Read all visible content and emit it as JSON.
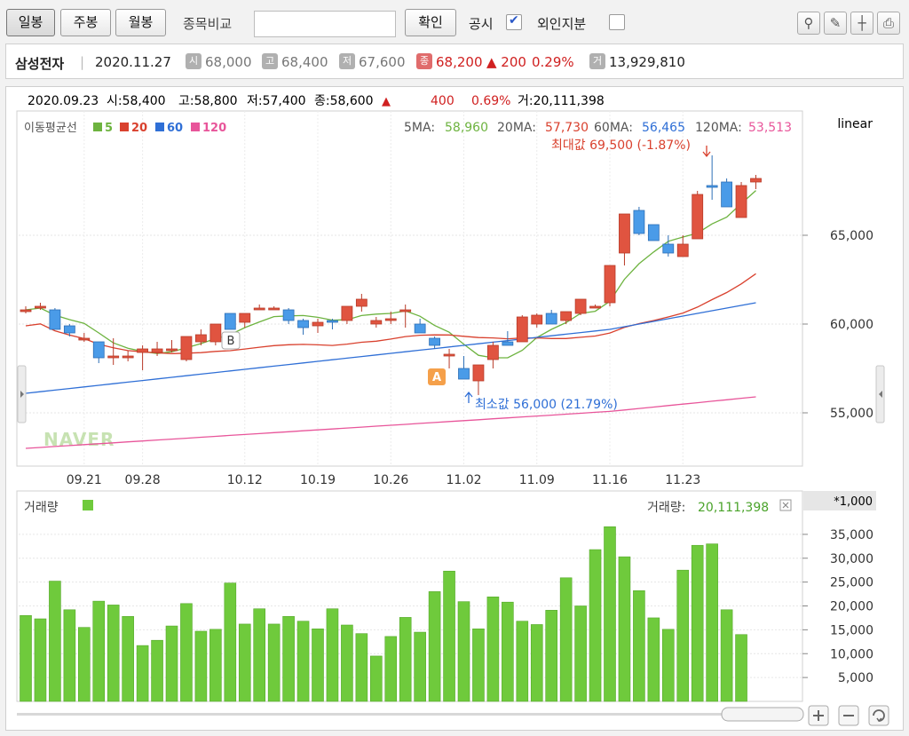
{
  "toolbar": {
    "daily_label": "일봉",
    "weekly_label": "주봉",
    "monthly_label": "월봉",
    "compare_label": "종목비교",
    "compare_placeholder": "",
    "confirm_label": "확인",
    "disclosure_label": "공시",
    "disclosure_checked": true,
    "foreign_label": "외인지분",
    "foreign_checked": false,
    "icons": [
      "pin-icon",
      "draw-icon",
      "cursor-icon",
      "print-icon"
    ]
  },
  "quote": {
    "name": "삼성전자",
    "date": "2020.11.27",
    "open_tag": "시",
    "open": "68,000",
    "high_tag": "고",
    "high": "68,400",
    "low_tag": "저",
    "low": "67,600",
    "close_tag": "종",
    "close": "68,200",
    "change": "▲ 200",
    "change_pct": "0.29%",
    "volume_tag": "거",
    "volume": "13,929,810"
  },
  "hover_info": {
    "date": "2020.09.23",
    "open": "시:58,400",
    "high": "고:58,800",
    "low": "저:57,400",
    "close": "종:58,600",
    "arrow": "▲",
    "change": "400",
    "change_pct": "0.69%",
    "volume": "거:20,111,398"
  },
  "chart_data": [
    {
      "type": "candlestick",
      "title": "",
      "scale_label": "linear",
      "ylim": [
        52000,
        72000
      ],
      "y_ticks": [
        "55,000",
        "60,000",
        "65,000"
      ],
      "x_ticks": [
        "09.21",
        "09.28",
        "10.12",
        "10.19",
        "10.26",
        "11.02",
        "11.09",
        "11.16",
        "11.23"
      ],
      "legend_title": "이동평균선",
      "legend": [
        {
          "name": "5",
          "color": "#6db33f"
        },
        {
          "name": "20",
          "color": "#d9412e"
        },
        {
          "name": "60",
          "color": "#2f6fd6"
        },
        {
          "name": "120",
          "color": "#e8559a"
        }
      ],
      "ma_values": [
        {
          "label": "5MA:",
          "value": "58,960",
          "color": "#6db33f"
        },
        {
          "label": "20MA:",
          "value": "57,730",
          "color": "#d9412e"
        },
        {
          "label": "60MA:",
          "value": "56,465",
          "color": "#2f6fd6"
        },
        {
          "label": "120MA:",
          "value": "53,513",
          "color": "#e8559a"
        }
      ],
      "max_label": "최대값 69,500 (-1.87%)",
      "min_label": "최소값 56,000 (21.79%)",
      "marker_a": "A",
      "marker_b": "B",
      "watermark": "NAVER",
      "candles": [
        [
          60800,
          61000,
          60600,
          60800
        ],
        [
          61000,
          61200,
          60800,
          61000
        ],
        [
          60800,
          60900,
          59700,
          59700
        ],
        [
          59900,
          60000,
          59300,
          59500
        ],
        [
          59200,
          59500,
          59000,
          59200
        ],
        [
          59000,
          59000,
          57800,
          58100
        ],
        [
          58200,
          59200,
          57700,
          58200
        ],
        [
          58100,
          58500,
          57900,
          58200
        ],
        [
          58400,
          58800,
          57400,
          58600
        ],
        [
          58400,
          59000,
          58200,
          58600
        ],
        [
          58600,
          59100,
          58400,
          58600
        ],
        [
          58000,
          59300,
          57900,
          59300
        ],
        [
          59000,
          59700,
          58800,
          59400
        ],
        [
          59000,
          60000,
          58800,
          60000
        ],
        [
          60600,
          60600,
          59700,
          59700
        ],
        [
          60100,
          60500,
          59800,
          60600
        ],
        [
          60900,
          61100,
          60800,
          60900
        ],
        [
          60900,
          61000,
          60800,
          60900
        ],
        [
          60800,
          60900,
          60000,
          60200
        ],
        [
          60200,
          60300,
          59400,
          59800
        ],
        [
          59900,
          60300,
          59500,
          60100
        ],
        [
          60200,
          60300,
          59700,
          60100
        ],
        [
          60200,
          61000,
          60000,
          61000
        ],
        [
          61000,
          61700,
          60700,
          61400
        ],
        [
          60000,
          60400,
          59800,
          60200
        ],
        [
          60200,
          60700,
          60000,
          60300
        ],
        [
          60800,
          61100,
          59800,
          60800
        ],
        [
          60000,
          60300,
          59600,
          59500
        ],
        [
          59200,
          59300,
          58600,
          58800
        ],
        [
          58200,
          58600,
          57500,
          58300
        ],
        [
          57500,
          58200,
          56900,
          56900
        ],
        [
          56800,
          57000,
          56000,
          57700
        ],
        [
          58000,
          59000,
          57500,
          58800
        ],
        [
          59000,
          59600,
          58800,
          58800
        ],
        [
          59000,
          60500,
          59000,
          60400
        ],
        [
          60000,
          60600,
          59800,
          60500
        ],
        [
          60600,
          60800,
          60000,
          60000
        ],
        [
          60200,
          60600,
          60000,
          60700
        ],
        [
          60600,
          61400,
          60500,
          61400
        ],
        [
          61000,
          61100,
          60900,
          61000
        ],
        [
          61200,
          63300,
          61000,
          63300
        ],
        [
          64000,
          66200,
          63300,
          66200
        ],
        [
          66400,
          66600,
          65000,
          65100
        ],
        [
          65600,
          65600,
          64800,
          64700
        ],
        [
          64500,
          65000,
          63800,
          64000
        ],
        [
          63800,
          65000,
          63800,
          64500
        ],
        [
          64800,
          67500,
          64800,
          67300
        ],
        [
          67800,
          69500,
          67000,
          67700
        ],
        [
          68000,
          68200,
          66700,
          66600
        ],
        [
          66000,
          68000,
          66000,
          67800
        ],
        [
          68000,
          68400,
          67600,
          68200
        ]
      ]
    },
    {
      "type": "bar",
      "title": "",
      "series_label": "거래량",
      "unit_label": "*1,000",
      "value_label": "거래량:",
      "value": "20,111,398",
      "ylim": [
        0,
        40000
      ],
      "y_ticks": [
        "5,000",
        "10,000",
        "15,000",
        "20,000",
        "25,000",
        "30,000",
        "35,000"
      ],
      "values": [
        18000,
        17300,
        25200,
        19200,
        15500,
        21000,
        20200,
        17800,
        11700,
        12800,
        15800,
        20500,
        14700,
        15100,
        24800,
        16200,
        19400,
        16200,
        17800,
        16800,
        15200,
        19400,
        16000,
        14200,
        9500,
        13600,
        17600,
        14500,
        23000,
        27300,
        20900,
        15200,
        21900,
        20800,
        16800,
        16100,
        19100,
        25900,
        20000,
        31800,
        36600,
        30300,
        23200,
        17500,
        15100,
        27500,
        32700,
        33000,
        19200,
        14000
      ]
    }
  ]
}
